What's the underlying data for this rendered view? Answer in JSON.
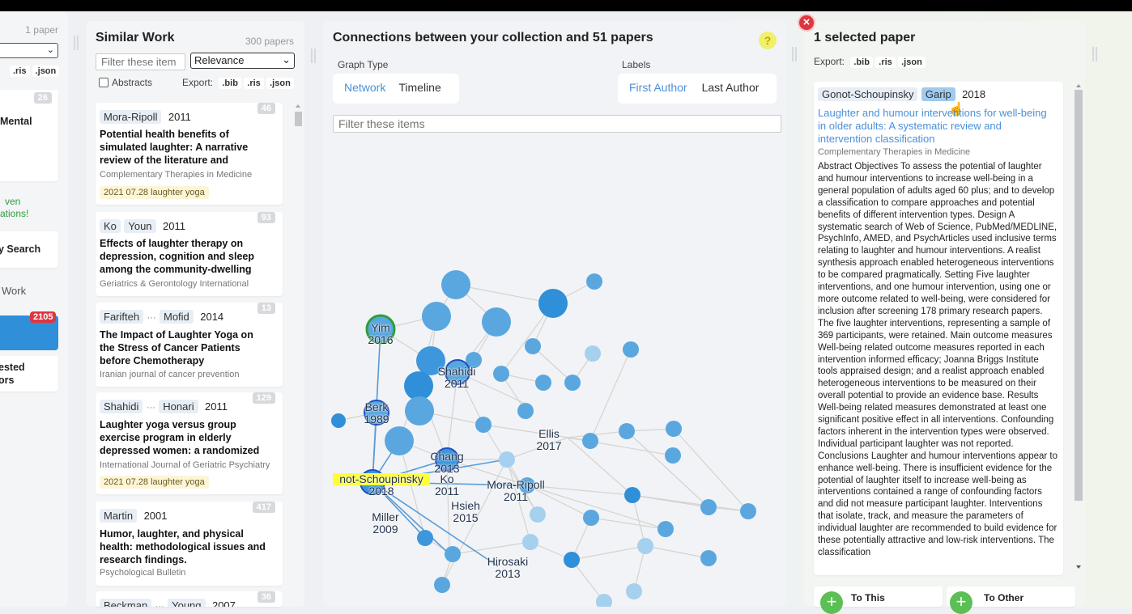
{
  "left": {
    "paper_count": "1 paper",
    "export_ris": ".ris",
    "export_json": ".json",
    "badge_26": "26",
    "card1_text": "Mental",
    "notice_line1": "ven",
    "notice_line2": "ations!",
    "search_label": "y Search",
    "work_label": "Work",
    "badge_2105": "2105",
    "suggested_line1": "ested",
    "suggested_line2": "ors"
  },
  "similar": {
    "title": "Similar Work",
    "count": "300 papers",
    "filter_placeholder": "Filter these item",
    "sort_selected": "Relevance",
    "abstracts_label": "Abstracts",
    "export_label": "Export:",
    "bib": ".bib",
    "ris": ".ris",
    "json": ".json",
    "papers": [
      {
        "authors": [
          "Mora-Ripoll"
        ],
        "year": "2011",
        "count": "46",
        "title": "Potential health benefits of simulated laughter: A narrative review of the literature and",
        "journal": "Complementary Therapies in Medicine",
        "tag": "2021 07.28 laughter yoga"
      },
      {
        "authors": [
          "Ko",
          "Youn"
        ],
        "year": "2011",
        "count": "93",
        "title": "Effects of laughter therapy on depression, cognition and sleep among the community-dwelling",
        "journal": "Geriatrics & Gerontology International",
        "tag": ""
      },
      {
        "authors": [
          "Farifteh",
          "···",
          "Mofid"
        ],
        "year": "2014",
        "count": "13",
        "title": "The Impact of Laughter Yoga on the Stress of Cancer Patients before Chemotherapy",
        "journal": "Iranian journal of cancer prevention",
        "tag": ""
      },
      {
        "authors": [
          "Shahidi",
          "···",
          "Honari"
        ],
        "year": "2011",
        "count": "129",
        "title": "Laughter yoga versus group exercise program in elderly depressed women: a randomized",
        "journal": "International Journal of Geriatric Psychiatry",
        "tag": "2021 07.28 laughter yoga"
      },
      {
        "authors": [
          "Martin"
        ],
        "year": "2001",
        "count": "417",
        "title": "Humor, laughter, and physical health: methodological issues and research findings.",
        "journal": "Psychological Bulletin",
        "tag": ""
      },
      {
        "authors": [
          "Beckman",
          "···",
          "Young"
        ],
        "year": "2007",
        "count": "36",
        "title": "",
        "journal": "",
        "tag": ""
      }
    ]
  },
  "graph": {
    "title": "Connections between your collection and 51 papers",
    "help_icon": "?",
    "graph_type_label": "Graph Type",
    "network_tab": "Network",
    "timeline_tab": "Timeline",
    "labels_label": "Labels",
    "first_author_tab": "First Author",
    "last_author_tab": "Last Author",
    "filter_placeholder": "Filter these items",
    "node_labels": [
      {
        "name": "Yim",
        "year": "2016"
      },
      {
        "name": "Shahidi",
        "year": "2011"
      },
      {
        "name": "Berk",
        "year": "1989"
      },
      {
        "name": "Ellis",
        "year": "2017"
      },
      {
        "name": "Chang",
        "year": "2013"
      },
      {
        "name": "not-Schoupinsky",
        "year": "2018"
      },
      {
        "name": "Ko",
        "year": "2011"
      },
      {
        "name": "Mora-Ripoll",
        "year": "2011"
      },
      {
        "name": "Hsieh",
        "year": "2015"
      },
      {
        "name": "Miller",
        "year": "2009"
      },
      {
        "name": "Hirosaki",
        "year": "2013"
      }
    ]
  },
  "selected": {
    "title": "1 selected paper",
    "export_label": "Export:",
    "bib": ".bib",
    "ris": ".ris",
    "json": ".json",
    "author1": "Gonot-Schoupinsky",
    "author2": "Garip",
    "year": "2018",
    "paper_title": "Laughter and humour interventions for well-being in older adults: A systematic review and intervention classification",
    "journal": "Complementary Therapies in Medicine",
    "abstract": "Abstract Objectives To assess the potential of laughter and humour interventions to increase well-being in a general population of adults aged 60 plus; and to develop a classification to compare approaches and potential benefits of different intervention types. Design A systematic search of Web of Science, PubMed/MEDLINE, PsychInfo, AMED, and PsychArticles used inclusive terms relating to laughter and humour interventions. A realist synthesis approach enabled heterogeneous interventions to be compared pragmatically. Setting Five laughter interventions, and one humour intervention, using one or more outcome related to well-being, were considered for inclusion after screening 178 primary research papers. The five laughter interventions, representing a sample of 369 participants, were retained. Main outcome measures Well-being related outcome measures reported in each intervention informed efficacy; Joanna Briggs Institute tools appraised design; and a realist approach enabled heterogeneous interventions to be measured on their overall potential to provide an evidence base. Results Well-being related measures demonstrated at least one significant positive effect in all interventions. Confounding factors inherent in the intervention types were observed. Individual participant laughter was not reported. Conclusions Laughter and humour interventions appear to enhance well-being. There is insufficient evidence for the potential of laughter itself to increase well-being as interventions contained a range of confounding factors and did not measure participant laughter. Interventions that isolate, track, and measure the parameters of individual laughter are recommended to build evidence for these potentially attractive and low-risk interventions. The classification",
    "to_this": "To This",
    "to_other": "To Other"
  },
  "colors": {
    "accent": "#4a90d9",
    "node": "#5aa7e0",
    "node_dark": "#2f8fd8",
    "highlight": "#ffff33",
    "badge_red": "#e0353f",
    "green": "#2e9e3a"
  }
}
